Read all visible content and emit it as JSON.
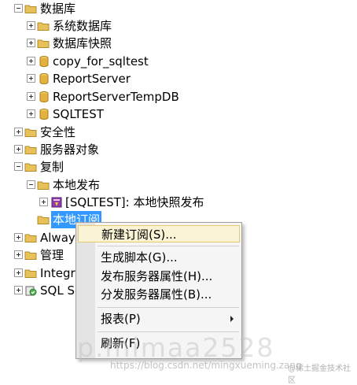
{
  "tree": {
    "databases": "数据库",
    "system_databases": "系统数据库",
    "database_snapshots": "数据库快照",
    "db1": "copy_for_sqltest",
    "db2": "ReportServer",
    "db3": "ReportServerTempDB",
    "db4": "SQLTEST",
    "security": "安全性",
    "server_objects": "服务器对象",
    "replication": "复制",
    "local_publications": "本地发布",
    "publication1": "[SQLTEST]: 本地快照发布",
    "local_subscriptions": "本地订阅",
    "alwayson": "Alway",
    "management": "管理",
    "integration": "Integr",
    "sql_server_agent": "SQL Se"
  },
  "context_menu": {
    "new_subscription": "新建订阅(S)...",
    "generate_scripts": "生成脚本(G)...",
    "publisher_properties": "发布服务器属性(H)...",
    "distributor_properties": "分发服务器属性(B)...",
    "reports": "报表(P)",
    "refresh": "刷新(F)"
  },
  "watermark": {
    "text": "p.mimaa2528",
    "url": "https://blog.csdn.net/mingxueming.zang",
    "logo": "@稀土掘金技术社区"
  },
  "colors": {
    "folder": "#e8c15a",
    "db": "#e3b23c",
    "selection": "#3399ff",
    "menu_highlight": "#fbf4d4"
  }
}
